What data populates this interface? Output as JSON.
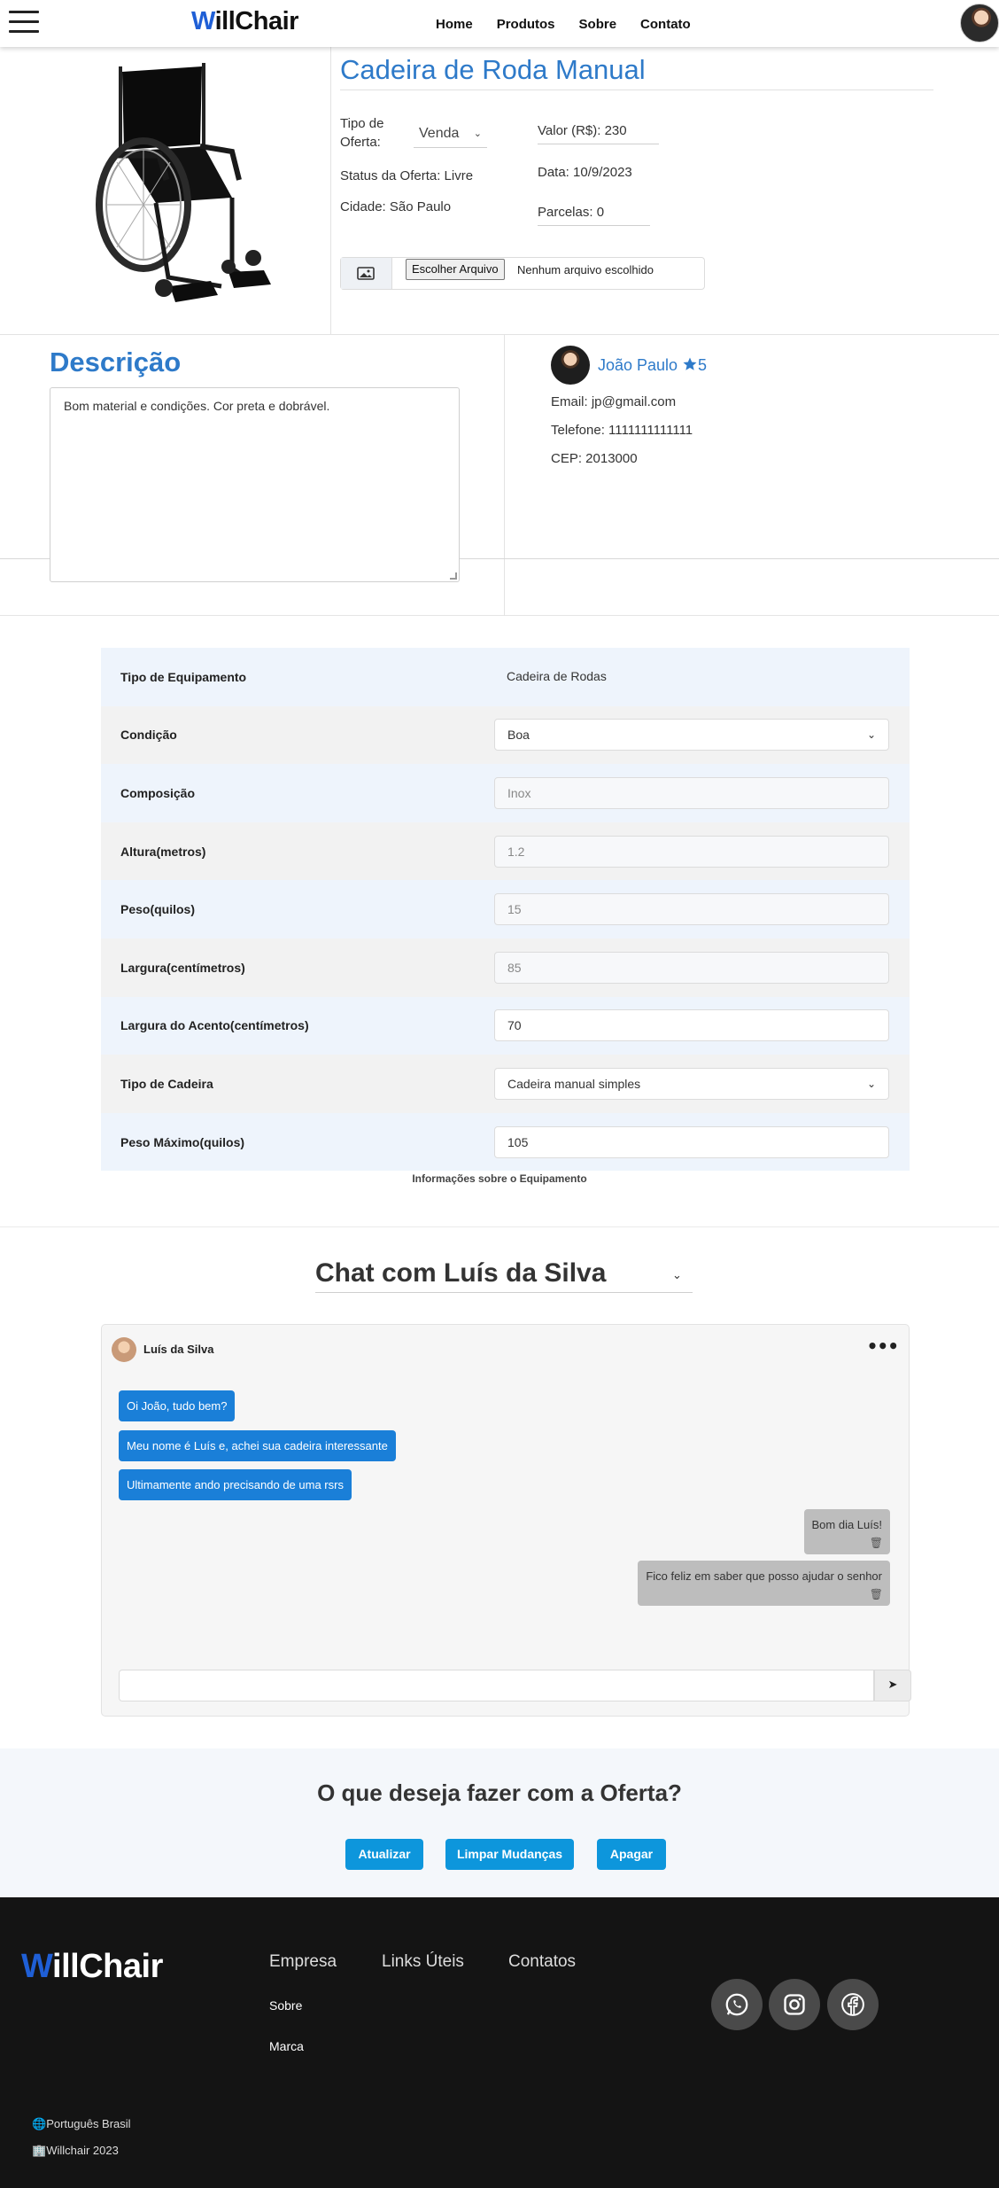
{
  "nav": {
    "brand_w": "W",
    "brand_rest": "illChair",
    "links": [
      "Home",
      "Produtos",
      "Sobre",
      "Contato"
    ]
  },
  "product": {
    "title": "Cadeira de Roda Manual",
    "offer_type_label": "Tipo de Oferta:",
    "offer_type_value": "Venda",
    "value_label": "Valor (R$): 230",
    "status_label": "Status da Oferta: Livre",
    "date_label": "Data: 10/9/2023",
    "city_label": "Cidade: São Paulo",
    "installments_label": "Parcelas: 0",
    "file_button": "Escolher Arquivo",
    "file_status": "Nenhum arquivo escolhido"
  },
  "description": {
    "title": "Descrição",
    "text": "Bom material e condições. Cor preta e dobrável."
  },
  "seller": {
    "name": "João Paulo",
    "rating": "5",
    "email": "Email: jp@gmail.com",
    "phone": "Telefone: 1111111111111",
    "cep": "CEP: 2013000"
  },
  "specs": {
    "rows": [
      {
        "label": "Tipo de Equipamento",
        "value": "Cadeira de Rodas"
      },
      {
        "label": "Condição",
        "value": "Boa"
      },
      {
        "label": "Composição",
        "value": "Inox"
      },
      {
        "label": "Altura(metros)",
        "value": "1.2"
      },
      {
        "label": "Peso(quilos)",
        "value": "15"
      },
      {
        "label": "Largura(centímetros)",
        "value": "85"
      },
      {
        "label": "Largura do Acento(centímetros)",
        "value": "70"
      },
      {
        "label": "Tipo de Cadeira",
        "value": "Cadeira manual simples"
      },
      {
        "label": "Peso Máximo(quilos)",
        "value": "105"
      }
    ],
    "caption": "Informações sobre o Equipamento"
  },
  "chat": {
    "title": "Chat com Luís da Silva",
    "contact_name": "Luís da Silva",
    "incoming": [
      "Oi João, tudo bem?",
      "Meu nome é Luís e, achei sua cadeira interessante",
      "Ultimamente ando precisando de uma rsrs"
    ],
    "outgoing": [
      "Bom dia Luís!",
      "Fico feliz em saber que posso ajudar o senhor"
    ]
  },
  "actions": {
    "title": "O que deseja fazer com a Oferta?",
    "update": "Atualizar",
    "clear": "Limpar Mudanças",
    "delete": "Apagar"
  },
  "footer": {
    "brand_w": "W",
    "brand_rest": "illChair",
    "col_company": "Empresa",
    "col_links": "Links Úteis",
    "col_contacts": "Contatos",
    "link_about": "Sobre",
    "link_brand": "Marca",
    "language": "Português Brasil",
    "copyright": "Willchair 2023"
  },
  "colors": {
    "accent_blue": "#2e7ac9",
    "chat_blue": "#1a7fd8",
    "button_blue": "#0d96dc",
    "footer_bg": "#141414"
  }
}
